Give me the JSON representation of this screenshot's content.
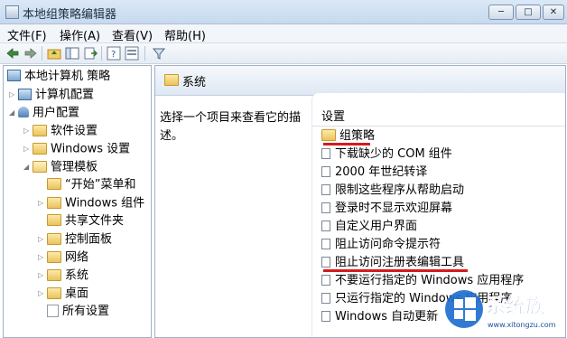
{
  "window": {
    "title": "本地组策略编辑器",
    "min": "─",
    "max": "□",
    "close": "✕"
  },
  "menu": {
    "file": "文件(F)",
    "action": "操作(A)",
    "view": "查看(V)",
    "help": "帮助(H)"
  },
  "tree": {
    "root": "本地计算机 策略",
    "computer": "计算机配置",
    "user": "用户配置",
    "software": "软件设置",
    "windows_settings": "Windows 设置",
    "admin_templates": "管理模板",
    "start_menu": "“开始”菜单和",
    "windows_components": "Windows 组件",
    "shared_folders": "共享文件夹",
    "control_panel": "控制面板",
    "network": "网络",
    "system": "系统",
    "desktop": "桌面",
    "all_settings": "所有设置"
  },
  "right": {
    "header": "系统",
    "description": "选择一个项目来查看它的描述。",
    "column": "设置",
    "items": [
      "组策略",
      "下载缺少的 COM 组件",
      "2000 年世纪转译",
      "限制这些程序从帮助启动",
      "登录时不显示欢迎屏幕",
      "自定义用户界面",
      "阻止访问命令提示符",
      "阻止访问注册表编辑工具",
      "不要运行指定的 Windows 应用程序",
      "只运行指定的 Windows 应用程序",
      "Windows 自动更新"
    ]
  },
  "watermark": {
    "brand": "系统族",
    "url": "www.xitongzu.com"
  }
}
